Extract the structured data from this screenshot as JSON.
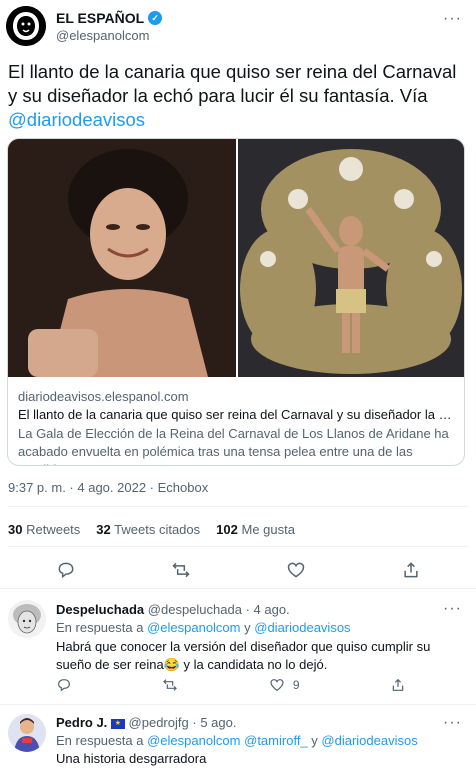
{
  "tweet": {
    "author_name": "EL ESPAÑOL",
    "author_handle": "@elespanolcom",
    "text": "El llanto de la canaria que quiso ser reina del Carnaval y su diseñador la echó para lucir él su fantasía. Vía ",
    "text_link": "@diariodeavisos",
    "card": {
      "domain": "diariodeavisos.elespanol.com",
      "title": "El llanto de la canaria que quiso ser reina del Carnaval y su diseñador la echó p...",
      "description": "La Gala de Elección de la Reina del Carnaval de Los Llanos de Aridane ha acabado envuelta en polémica tras una tensa pelea entre una de las candidata..."
    },
    "time": "9:37 p. m.",
    "date": "4 ago. 2022",
    "source": "Echobox",
    "retweets_count": "30",
    "retweets_label": "Retweets",
    "quotes_count": "32",
    "quotes_label": "Tweets citados",
    "likes_count": "102",
    "likes_label": "Me gusta"
  },
  "replies": [
    {
      "name": "Despeluchada",
      "handle": "@despeluchada",
      "date": "4 ago.",
      "reply_to_label": "En respuesta a",
      "reply_to_1": "@elespanolcom",
      "reply_to_sep": "y",
      "reply_to_2": "@diariodeavisos",
      "text": "Habrá que conocer la versión del diseñador que quiso cumplir su sueño de ser reina😂 y la candidata no lo dejó.",
      "likes": "9"
    },
    {
      "name": "Pedro J.",
      "handle": "@pedrojfg",
      "date": "5 ago.",
      "reply_to_label": "En respuesta a",
      "reply_to_1": "@elespanolcom",
      "reply_to_2": "@tamiroff_",
      "reply_to_sep": "y",
      "reply_to_3": "@diariodeavisos",
      "text": "Una historia desgarradora"
    }
  ],
  "colors": {
    "accent": "#1d9bf0",
    "muted": "#536471",
    "text": "#0f1419"
  }
}
